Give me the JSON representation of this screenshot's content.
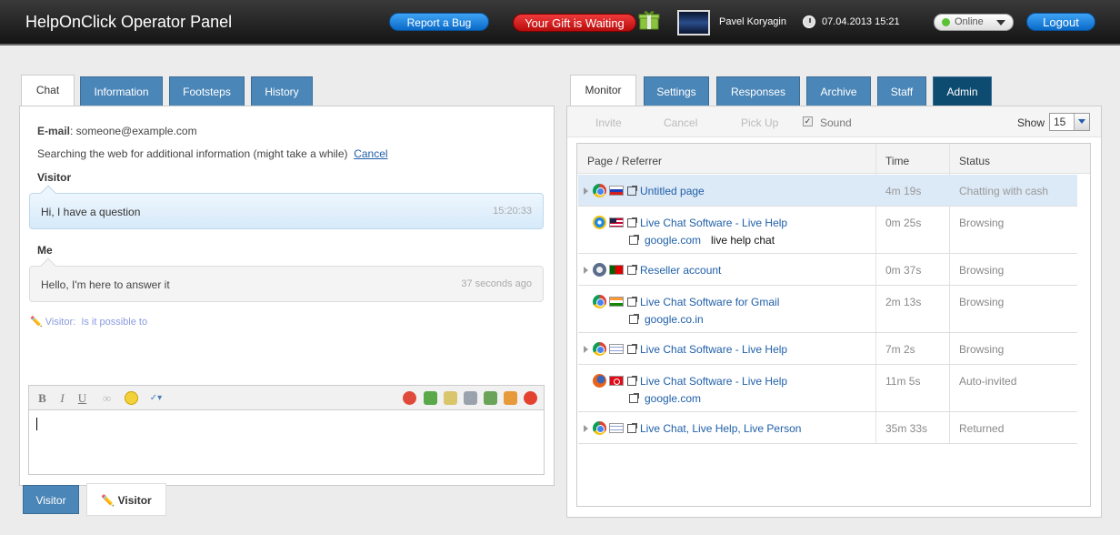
{
  "header": {
    "title": "HelpOnClick Operator Panel",
    "report_bug": "Report a Bug",
    "gift": "Your Gift is Waiting",
    "user_name": "Pavel Koryagin",
    "datetime": "07.04.2013 15:21",
    "status": "Online",
    "logout": "Logout"
  },
  "left_tabs": [
    "Chat",
    "Information",
    "Footsteps",
    "History"
  ],
  "chat": {
    "email_label": "E-mail",
    "email_value": ": someone@example.com",
    "search_text": "Searching the web for additional information (might take a while)",
    "cancel": "Cancel",
    "visitor_label": "Visitor",
    "visitor_msg": "Hi, I have a question",
    "visitor_time": "15:20:33",
    "me_label": "Me",
    "me_msg": "Hello, I'm here to answer it",
    "me_time": "37 seconds ago",
    "typing_prefix": "Visitor:",
    "typing_text": "Is it possible to"
  },
  "bottom_tabs": {
    "visitor": "Visitor",
    "typing": "Visitor"
  },
  "right_tabs": [
    "Monitor",
    "Settings",
    "Responses",
    "Archive",
    "Staff",
    "Admin"
  ],
  "actions": {
    "invite": "Invite",
    "cancel": "Cancel",
    "pickup": "Pick Up",
    "sound": "Sound",
    "show": "Show",
    "show_value": "15"
  },
  "table": {
    "headers": [
      "Page / Referrer",
      "Time",
      "Status"
    ],
    "rows": [
      {
        "page": "Untitled page",
        "time": "4m 19s",
        "status": "Chatting with cash",
        "browser": "chrome",
        "flag": "ru"
      },
      {
        "page": "Live Chat Software - Live Help",
        "referrer": "google.com",
        "keyword": "live help chat",
        "time": "0m 25s",
        "status": "Browsing",
        "browser": "ie",
        "flag": "us"
      },
      {
        "page": "Reseller account",
        "time": "0m 37s",
        "status": "Browsing",
        "browser": "opera",
        "flag": "pt"
      },
      {
        "page": "Live Chat Software for Gmail",
        "referrer": "google.co.in",
        "time": "2m 13s",
        "status": "Browsing",
        "browser": "chrome",
        "flag": "in"
      },
      {
        "page": "Live Chat Software - Live Help",
        "time": "7m 2s",
        "status": "Browsing",
        "browser": "chrome",
        "flag": "il"
      },
      {
        "page": "Live Chat Software - Live Help",
        "referrer": "google.com",
        "time": "11m 5s",
        "status": "Auto-invited",
        "browser": "firefox",
        "flag": "tr"
      },
      {
        "page": "Live Chat, Live Help, Live Person",
        "time": "35m 33s",
        "status": "Returned",
        "browser": "chrome",
        "flag": "il"
      }
    ]
  }
}
